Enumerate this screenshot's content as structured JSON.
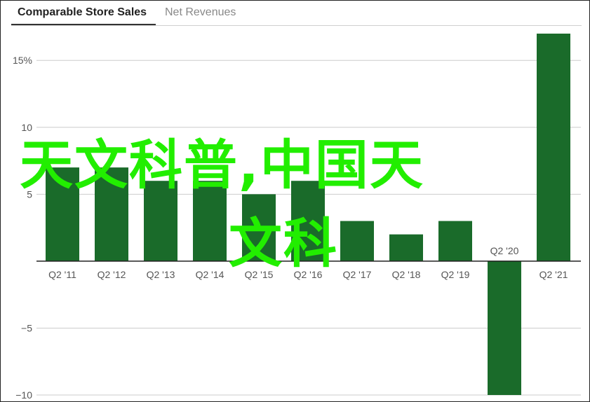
{
  "tabs": {
    "active_label": "Comparable Store Sales",
    "inactive_label": "Net Revenues"
  },
  "colors": {
    "bar": "#1a6b2a",
    "overlay_text": "#22ee00"
  },
  "chart_data": {
    "type": "bar",
    "categories": [
      "Q2 '11",
      "Q2 '12",
      "Q2 '13",
      "Q2 '14",
      "Q2 '15",
      "Q2 '16",
      "Q2 '17",
      "Q2 '18",
      "Q2 '19",
      "Q2 '20",
      "Q2 '21"
    ],
    "values": [
      7,
      7,
      6,
      6,
      5,
      6,
      3,
      2,
      3,
      -10,
      17
    ],
    "ylim": [
      -10,
      17
    ],
    "yticks": [
      -10,
      -5,
      0,
      5,
      10,
      15
    ],
    "ytick_labels": [
      "−10",
      "−5",
      "",
      "5",
      "10",
      "15%"
    ],
    "title": "",
    "xlabel": "",
    "ylabel": "",
    "grid": true
  },
  "overlay": {
    "line1": "天文科普,中国天",
    "line2": "文科"
  }
}
